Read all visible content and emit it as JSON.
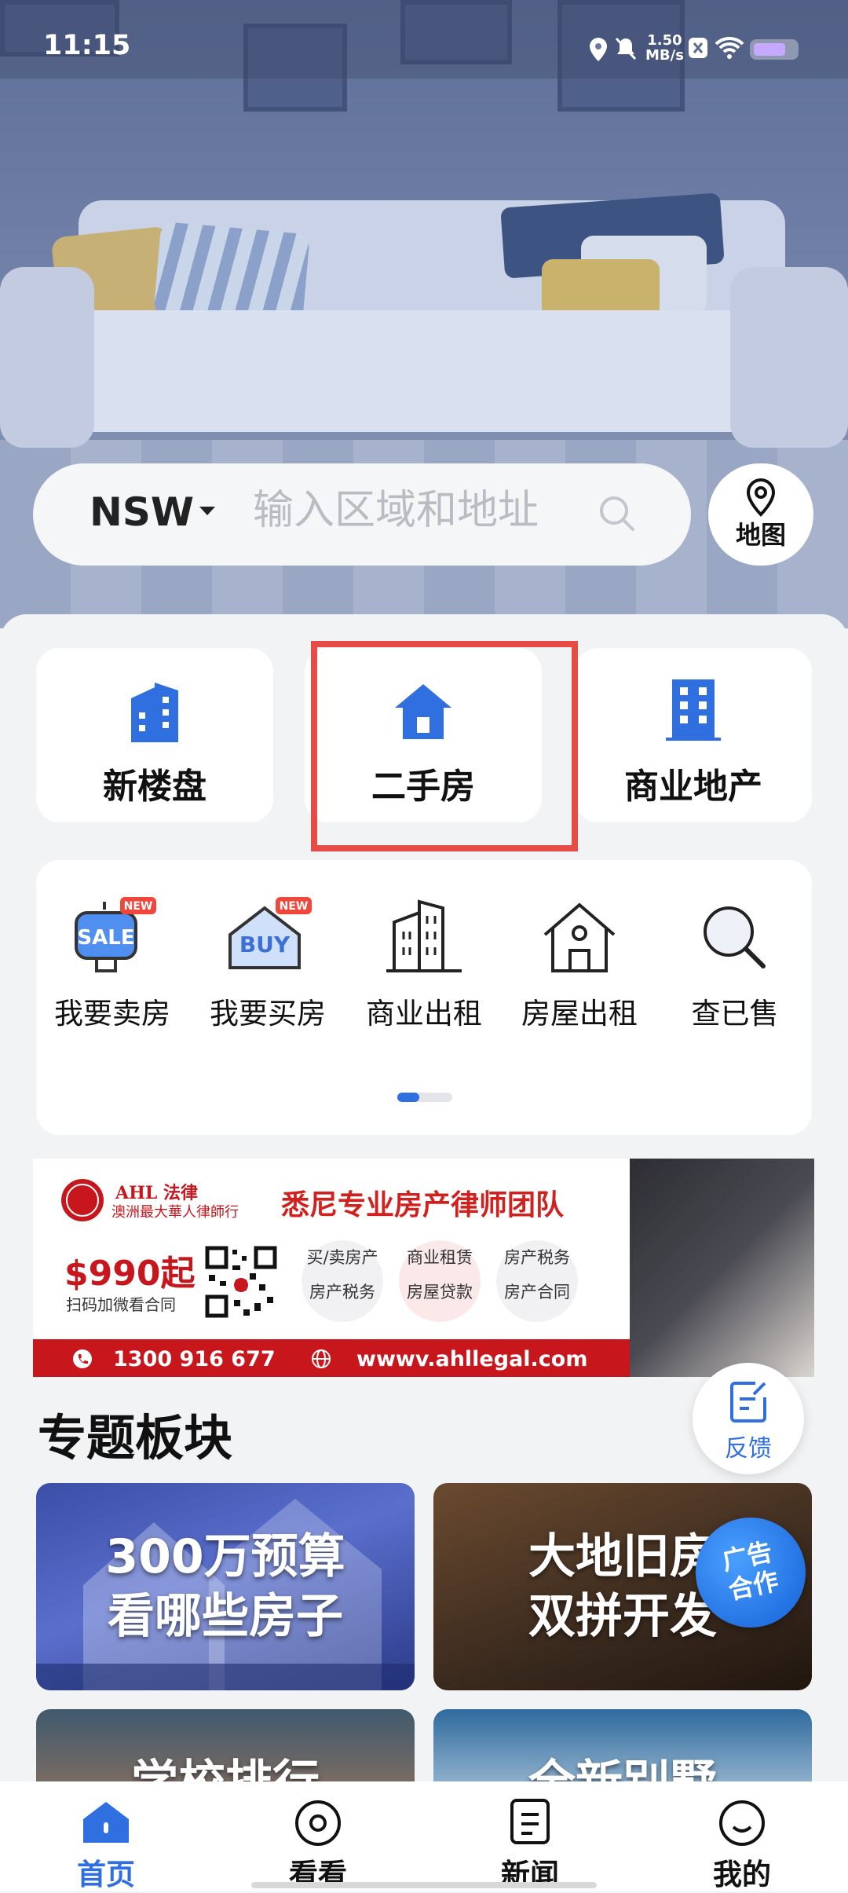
{
  "status_bar": {
    "time": "11:15",
    "net_speed": "1.50",
    "net_unit": "MB/s"
  },
  "search": {
    "state": "NSW",
    "placeholder": "输入区域和地址",
    "map_label": "地图"
  },
  "categories": [
    {
      "label": "新楼盘",
      "icon": "building-icon"
    },
    {
      "label": "二手房",
      "icon": "house-icon"
    },
    {
      "label": "商业地产",
      "icon": "office-tower-icon"
    }
  ],
  "services": [
    {
      "label": "我要卖房",
      "badge": "NEW",
      "sign": "SALE"
    },
    {
      "label": "我要买房",
      "badge": "NEW",
      "sign": "BUY"
    },
    {
      "label": "商业出租"
    },
    {
      "label": "房屋出租"
    },
    {
      "label": "查已售"
    }
  ],
  "banner": {
    "brand": "AHL 法律",
    "brand_sub": "澳洲最大華人律師行",
    "headline": "悉尼专业房产律师团队",
    "price": "$990起",
    "price_sub": "扫码加微看合同",
    "bubbles": [
      [
        "买/卖房产",
        "房产税务"
      ],
      [
        "商业租赁",
        "房屋贷款"
      ],
      [
        "房产税务",
        "房产合同"
      ]
    ],
    "phone": "1300 916 677",
    "website": "wwwv.ahllegal.com"
  },
  "section": {
    "title": "专题板块",
    "feedback": "反馈",
    "ad_badge_1": "广告",
    "ad_badge_2": "合作"
  },
  "topics": [
    {
      "line1": "300万预算",
      "line2": "看哪些房子"
    },
    {
      "line1": "大地旧房",
      "line2": "双拼开发"
    },
    {
      "line1": "学校排行",
      "line2": ""
    },
    {
      "line1": "全新别墅",
      "line2": ""
    }
  ],
  "tabs": [
    {
      "label": "首页",
      "active": true
    },
    {
      "label": "看看"
    },
    {
      "label": "新闻"
    },
    {
      "label": "我的"
    }
  ],
  "colors": {
    "accent": "#2f6fe0",
    "highlight": "#e64b45",
    "banner_red": "#c8161d"
  }
}
